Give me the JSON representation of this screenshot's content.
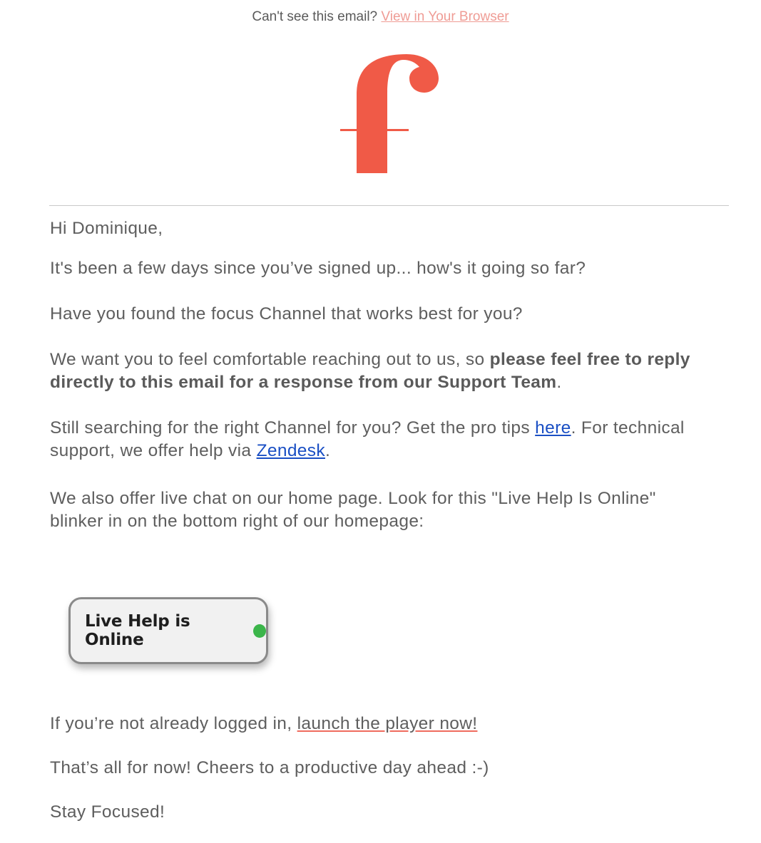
{
  "header": {
    "prefix": "Can't see this email?",
    "view_link": "View in Your Browser"
  },
  "logo": {
    "icon": "f-logo-icon",
    "color": "#f05a47"
  },
  "email": {
    "greeting": "Hi Dominique,",
    "p1": "It's been a few days since you’ve signed up... how's it going so far?",
    "p2": "Have you found the focus Channel that works best for you?",
    "p3_start": "We want you to feel comfortable reaching out to us, so ",
    "p3_bold": "please feel free to reply directly to this email for a response from our Support Team",
    "p3_end": ".",
    "p4_start": "Still searching for the right Channel for you? Get the pro tips ",
    "p4_link1": "here",
    "p4_mid": ". For technical support, we offer help via ",
    "p4_link2": "Zendesk",
    "p4_end": ".",
    "p5": "We also offer live chat on our home page. Look for this \"Live Help Is Online\" blinker in on the bottom right of our homepage:",
    "live_button_label": "Live Help is Online",
    "live_dot_color": "#3bb54a",
    "p6_start": "If you’re not already logged in, ",
    "p6_link": "launch the player now!",
    "p7": "That’s all for now! Cheers to a productive day ahead :-)",
    "signoff": "Stay Focused!"
  }
}
